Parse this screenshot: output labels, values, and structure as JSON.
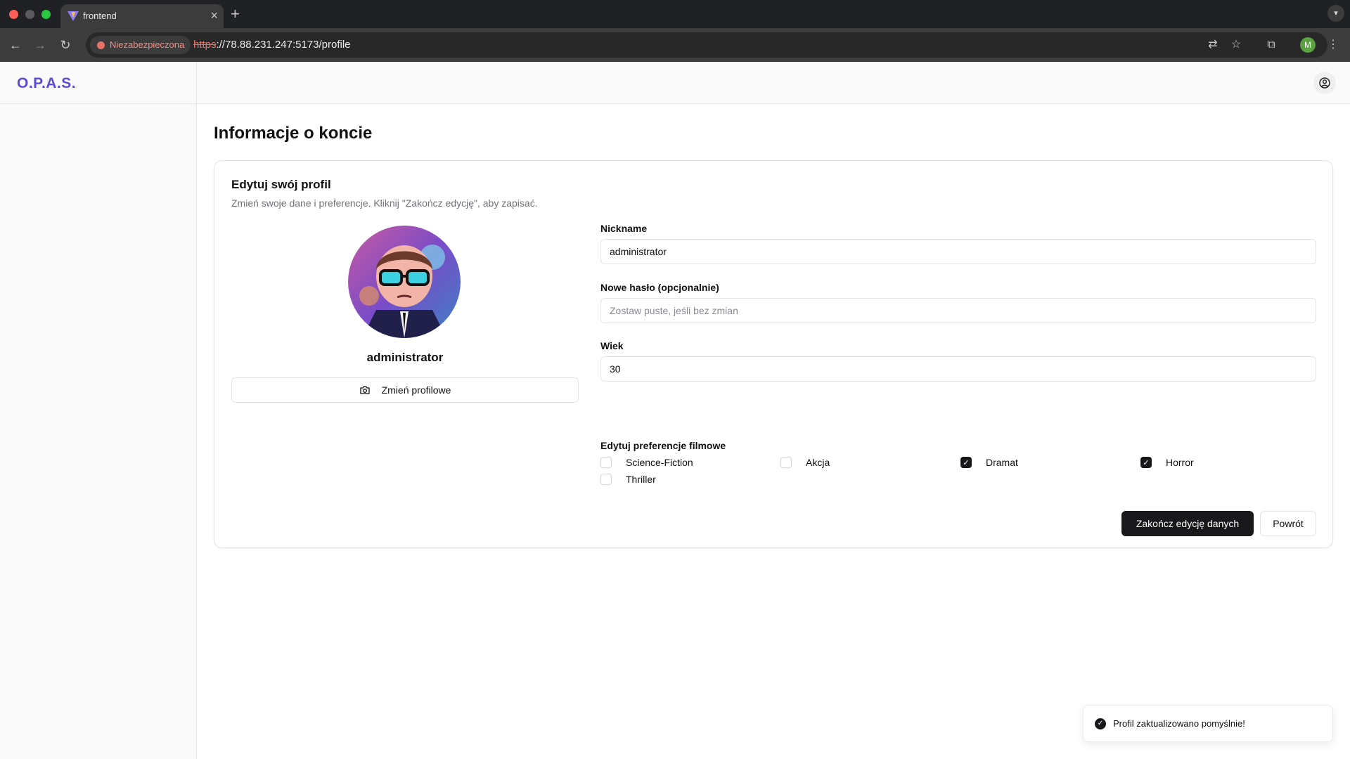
{
  "browser": {
    "tab_title": "frontend",
    "new_tab_symbol": "+",
    "close_symbol": "×",
    "security_label": "Niezabezpieczona",
    "url_scheme": "https",
    "url_rest": "://78.88.231.247:5173/profile",
    "profile_initial": "M"
  },
  "app": {
    "brand": "O.P.A.S.",
    "page_title": "Informacje o koncie",
    "card": {
      "title": "Edytuj swój profil",
      "description": "Zmień swoje dane i preferencje. Kliknij \"Zakończ edycję\", aby zapisać.",
      "username": "administrator",
      "change_photo_label": "Zmień profilowe"
    },
    "form": {
      "nickname_label": "Nickname",
      "nickname_value": "administrator",
      "password_label": "Nowe hasło (opcjonalnie)",
      "password_placeholder": "Zostaw puste, jeśli bez zmian",
      "age_label": "Wiek",
      "age_value": "30",
      "preferences_label": "Edytuj preferencje filmowe",
      "genres": [
        {
          "label": "Science-Fiction",
          "checked": false
        },
        {
          "label": "Akcja",
          "checked": false
        },
        {
          "label": "Dramat",
          "checked": true
        },
        {
          "label": "Horror",
          "checked": true
        },
        {
          "label": "Thriller",
          "checked": false
        }
      ],
      "submit_label": "Zakończ edycję danych",
      "back_label": "Powrót"
    },
    "toast": "Profil zaktualizowano pomyślnie!"
  },
  "colors": {
    "brand": "#5b4bdb",
    "primary_button": "#18181b",
    "insecure": "#e57368"
  }
}
